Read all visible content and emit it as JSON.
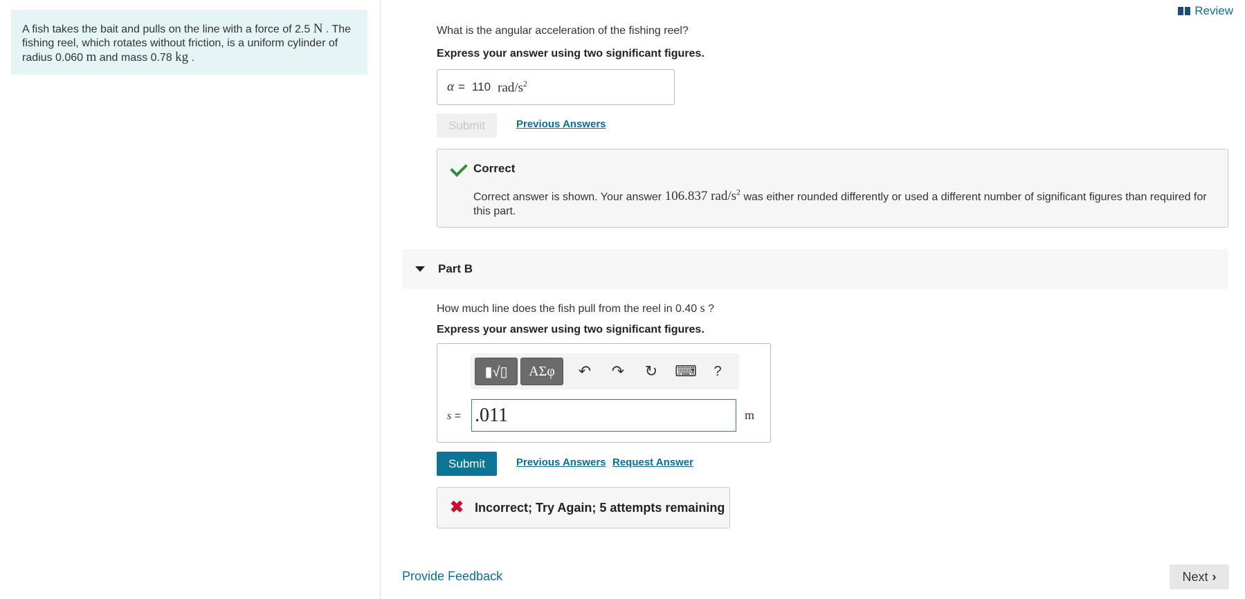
{
  "review": {
    "label": "Review",
    "icon": "book-icon"
  },
  "problem": {
    "t1": "A fish takes the bait and pulls on the line with a force of 2.5",
    "u1": "N",
    "t2": ". The fishing reel, which rotates without friction, is a uniform cylinder of radius 0.060",
    "u2": "m",
    "t3": "and mass 0.78",
    "u3": "kg",
    "t4": "."
  },
  "partA": {
    "question": "What is the angular acceleration of the fishing reel?",
    "instruction": "Express your answer using two significant figures.",
    "var_label": "α",
    "equals": "=",
    "value": "110",
    "unit": "rad/s",
    "unit_exp": "2",
    "submit_label": "Submit",
    "previous_answers": "Previous Answers",
    "feedback": {
      "title": "Correct",
      "msg_pre": "Correct answer is shown. Your answer",
      "your_answer": "106.837 rad/s",
      "your_answer_exp": "2",
      "msg_post": "was either rounded differently or used a different number of significant figures than required for this part."
    }
  },
  "partB": {
    "title": "Part B",
    "question_pre": "How much line does the fish pull from the reel in 0.40",
    "question_unit": "s",
    "question_post": "?",
    "instruction": "Express your answer using two significant figures.",
    "toolbar": {
      "templates": "▮√▯",
      "symbols": "ΑΣφ",
      "undo": "↶",
      "redo": "↷",
      "reset": "↻",
      "keyboard": "⌨",
      "help": "?"
    },
    "var_label": "s",
    "equals": "=",
    "input_value": ".011",
    "unit": "m",
    "submit_label": "Submit",
    "previous_answers": "Previous Answers",
    "request_answer": "Request Answer",
    "feedback": "Incorrect; Try Again; 5 attempts remaining"
  },
  "footer": {
    "provide_feedback": "Provide Feedback",
    "next": "Next"
  }
}
